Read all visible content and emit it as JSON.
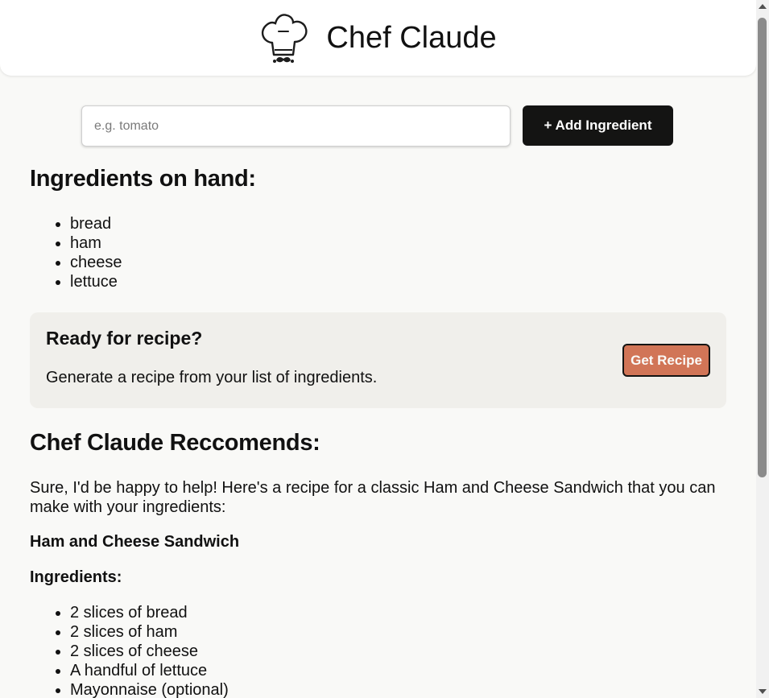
{
  "header": {
    "title": "Chef Claude",
    "logo_icon": "chef-hat-mustache-icon"
  },
  "form": {
    "input_placeholder": "e.g. tomato",
    "input_value": "",
    "add_button_label": "+ Add Ingredient"
  },
  "ingredients_section": {
    "heading": "Ingredients on hand:",
    "items": [
      "bread",
      "ham",
      "cheese",
      "lettuce"
    ]
  },
  "recipe_cta": {
    "heading": "Ready for recipe?",
    "text": "Generate a recipe from your list of ingredients.",
    "button_label": "Get Recipe"
  },
  "recommendation": {
    "heading": "Chef Claude Reccomends:",
    "intro": "Sure, I'd be happy to help! Here's a recipe for a classic Ham and Cheese Sandwich that you can make with your ingredients:",
    "recipe_name": "Ham and Cheese Sandwich",
    "ingredients_label": "Ingredients:",
    "ingredients": [
      "2 slices of bread",
      "2 slices of ham",
      "2 slices of cheese",
      "A handful of lettuce",
      "Mayonnaise (optional)"
    ]
  },
  "colors": {
    "page_background": "#f9f9f7",
    "primary_button": "#141413",
    "accent_button": "#d17557",
    "card_background": "#f0efeb"
  }
}
